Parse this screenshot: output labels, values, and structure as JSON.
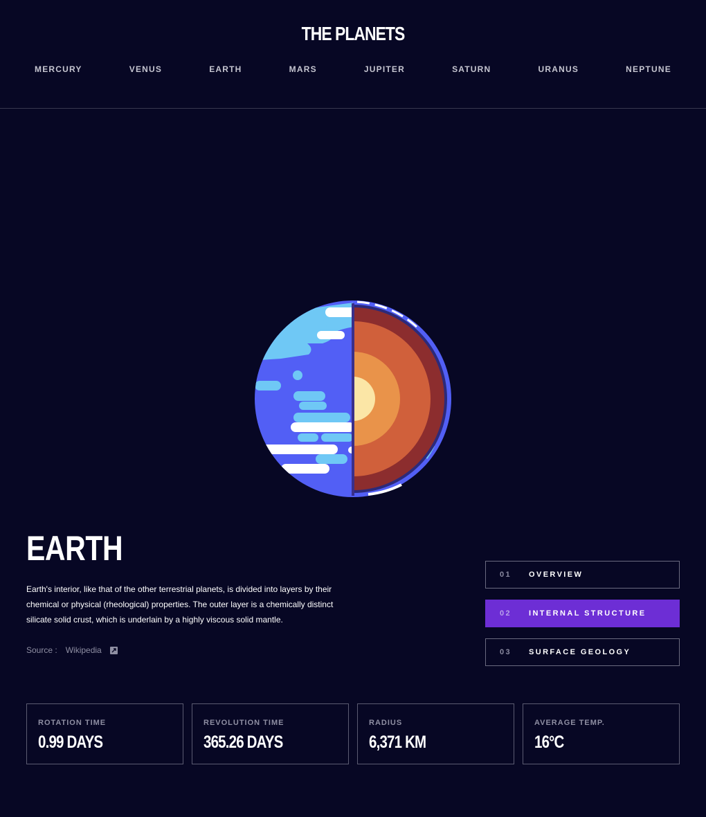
{
  "header": {
    "logo": "THE PLANETS",
    "nav": [
      "MERCURY",
      "VENUS",
      "EARTH",
      "MARS",
      "JUPITER",
      "SATURN",
      "URANUS",
      "NEPTUNE"
    ]
  },
  "planet": {
    "name": "EARTH",
    "description": "Earth's interior, like that of the other terrestrial planets, is divided into layers by their chemical or physical (rheological) properties. The outer layer is a chemically distinct silicate solid crust, which is underlain by a highly viscous solid mantle.",
    "source_label": "Source :",
    "source_link": "Wikipedia",
    "source_icon": "external-link-icon"
  },
  "tabs": [
    {
      "num": "01",
      "label": "OVERVIEW",
      "active": false
    },
    {
      "num": "02",
      "label": "INTERNAL STRUCTURE",
      "active": true
    },
    {
      "num": "03",
      "label": "SURFACE GEOLOGY",
      "active": false
    }
  ],
  "stats": [
    {
      "label": "ROTATION TIME",
      "value": "0.99 DAYS"
    },
    {
      "label": "REVOLUTION TIME",
      "value": "365.26 DAYS"
    },
    {
      "label": "RADIUS",
      "value": "6,371 KM"
    },
    {
      "label": "AVERAGE TEMP.",
      "value": "16°C"
    }
  ],
  "colors": {
    "background": "#070724",
    "accent": "#6d2ed5",
    "border": "#38384f"
  }
}
